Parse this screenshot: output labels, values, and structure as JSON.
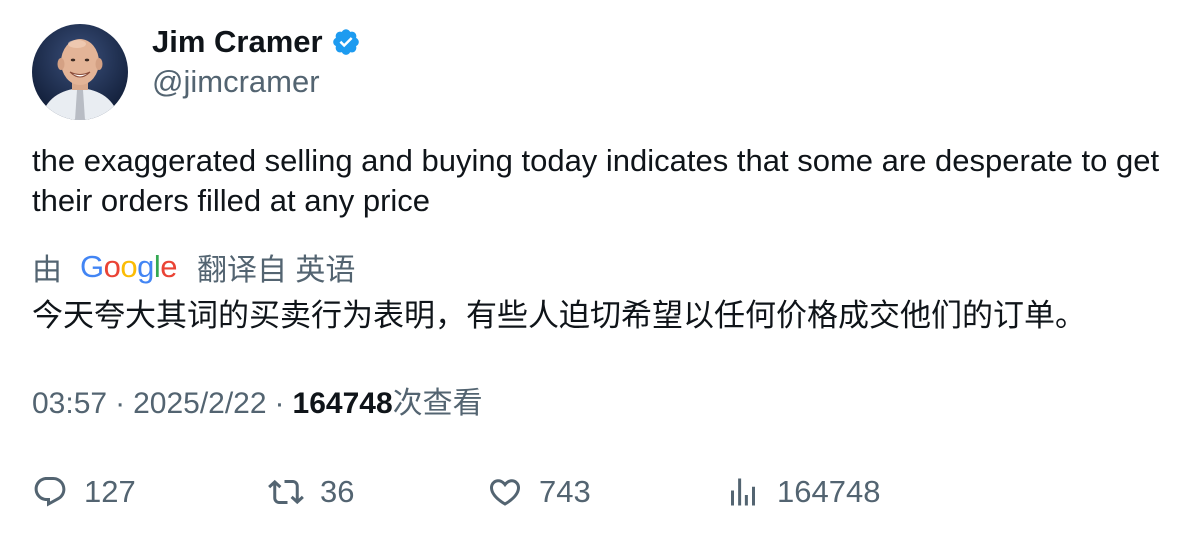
{
  "author": {
    "name": "Jim Cramer",
    "handle": "@jimcramer",
    "verified": true,
    "avatar": "avatar-portrait"
  },
  "tweet": {
    "text": "the exaggerated selling and buying today indicates that some are desperate to get their orders filled at any price"
  },
  "translation": {
    "by_label": "由",
    "provider": [
      "G",
      "o",
      "o",
      "g",
      "l",
      "e"
    ],
    "provider_colors": [
      "#4285F4",
      "#EA4335",
      "#FBBC05",
      "#4285F4",
      "#34A853",
      "#EA4335"
    ],
    "from_label": "翻译自 英语",
    "text": "今天夸大其词的买卖行为表明，有些人迫切希望以任何价格成交他们的订单。"
  },
  "meta": {
    "time": "03:57",
    "separator": "·",
    "date": "2025/2/22",
    "views_count": "164748",
    "views_label": "次查看"
  },
  "actions": {
    "reply_count": "127",
    "retweet_count": "36",
    "like_count": "743",
    "views_count": "164748"
  },
  "colors": {
    "text_primary": "#0f1419",
    "text_secondary": "#536471",
    "verified_blue": "#1d9bf0"
  }
}
